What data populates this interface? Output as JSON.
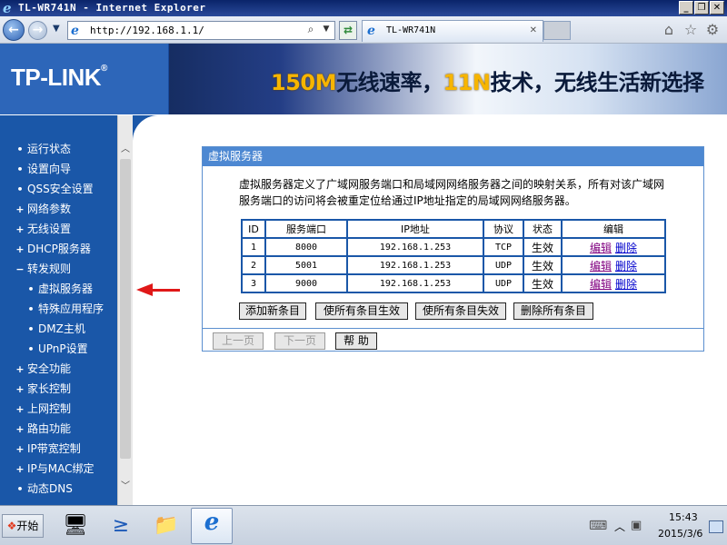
{
  "window": {
    "title": "TL-WR741N - Internet Explorer",
    "controls": {
      "minimize": "_",
      "maximize": "❐",
      "close": "✕"
    }
  },
  "navbar": {
    "url": "http://192.168.1.1/",
    "tab_title": "TL-WR741N"
  },
  "header": {
    "logo": "TP-LINK",
    "slogan_part1": "150M",
    "slogan_part2": "无线速率，",
    "slogan_part3": "11N",
    "slogan_part4": "技术，无线生活新选择"
  },
  "sidebar": {
    "items": [
      {
        "bullet": "•",
        "label": "运行状态"
      },
      {
        "bullet": "•",
        "label": "设置向导"
      },
      {
        "bullet": "•",
        "label": "QSS安全设置"
      },
      {
        "bullet": "+",
        "label": "网络参数"
      },
      {
        "bullet": "+",
        "label": "无线设置"
      },
      {
        "bullet": "+",
        "label": "DHCP服务器"
      },
      {
        "bullet": "−",
        "label": "转发规则"
      },
      {
        "bullet": "•",
        "label": "虚拟服务器"
      },
      {
        "bullet": "•",
        "label": "特殊应用程序"
      },
      {
        "bullet": "•",
        "label": "DMZ主机"
      },
      {
        "bullet": "•",
        "label": "UPnP设置"
      },
      {
        "bullet": "+",
        "label": "安全功能"
      },
      {
        "bullet": "+",
        "label": "家长控制"
      },
      {
        "bullet": "+",
        "label": "上网控制"
      },
      {
        "bullet": "+",
        "label": "路由功能"
      },
      {
        "bullet": "+",
        "label": "IP带宽控制"
      },
      {
        "bullet": "+",
        "label": "IP与MAC绑定"
      },
      {
        "bullet": "•",
        "label": "动态DNS"
      }
    ]
  },
  "panel": {
    "title": "虚拟服务器",
    "description_line1": "虚拟服务器定义了广域网服务端口和局域网网络服务器之间的映射关系，所有对该广域网",
    "description_line2": "服务端口的访问将会被重定位给通过IP地址指定的局域网网络服务器。",
    "columns": [
      "ID",
      "服务端口",
      "IP地址",
      "协议",
      "状态",
      "编辑"
    ],
    "rows": [
      {
        "id": "1",
        "port": "8000",
        "ip": "192.168.1.253",
        "protocol": "TCP",
        "status": "生效",
        "edit": "编辑",
        "delete": "删除"
      },
      {
        "id": "2",
        "port": "5001",
        "ip": "192.168.1.253",
        "protocol": "UDP",
        "status": "生效",
        "edit": "编辑",
        "delete": "删除"
      },
      {
        "id": "3",
        "port": "9000",
        "ip": "192.168.1.253",
        "protocol": "UDP",
        "status": "生效",
        "edit": "编辑",
        "delete": "删除"
      }
    ],
    "buttons": {
      "add": "添加新条目",
      "enable_all": "使所有条目生效",
      "disable_all": "使所有条目失效",
      "delete_all": "删除所有条目",
      "prev": "上一页",
      "next": "下一页",
      "help": "帮 助"
    }
  },
  "taskbar": {
    "start": "开始",
    "time": "15:43",
    "date": "2015/3/6"
  },
  "colors": {
    "sidebar": "#1a57a8",
    "panel_title": "#4d88d2",
    "arrow": "#e01818"
  }
}
